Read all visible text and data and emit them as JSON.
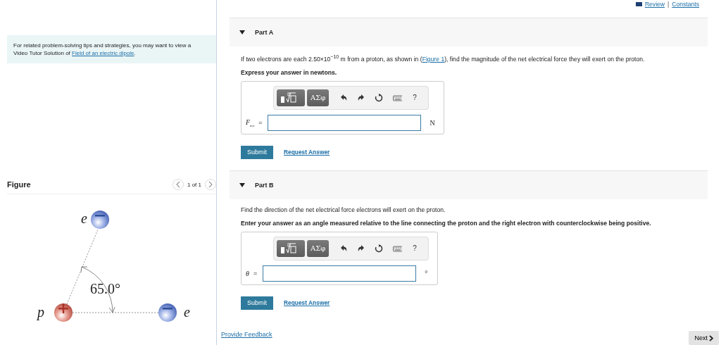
{
  "header_links": {
    "items": [
      {
        "label": "Review"
      },
      {
        "label": "Constants"
      }
    ],
    "separator": "|"
  },
  "tip": {
    "text": "For related problem-solving tips and strategies, you may want to view a Video Tutor Solution of ",
    "link": "Field of an electric dipole",
    "end": "."
  },
  "figure": {
    "title": "Figure",
    "counter": "1 of 1",
    "labels": {
      "top_electron": "e",
      "right_electron": "e",
      "proton": "p",
      "angle": "65.0°"
    }
  },
  "parts": [
    {
      "title": "Part A",
      "expanded": true,
      "question": "If two electrons are each 2.50×10$^{−10}$ m from a proton, as shown in (",
      "question_link": "Figure 1",
      "question_end": "), find the magnitude of the net electrical force they will exert on the proton.",
      "instruction": "Express your answer in newtons.",
      "toolbar": {
        "greek": "ΑΣφ",
        "help": "?"
      },
      "answer": {
        "variable": "F$_{net}$",
        "equals": "=",
        "unit": "N"
      },
      "buttons": {
        "submit": "Submit",
        "request": "Request Answer"
      }
    },
    {
      "title": "Part B",
      "expanded": true,
      "question": "Find the direction of the net electrical force electrons will exert on the proton.",
      "instruction": "Enter your answer as an angle measured relative to the line connecting the proton and the right electron with counterclockwise being positive.",
      "toolbar": {
        "greek": "ΑΣφ",
        "help": "?"
      },
      "answer": {
        "variable": "θ",
        "equals": "=",
        "unit": "°"
      },
      "buttons": {
        "submit": "Submit",
        "request": "Request Answer"
      }
    }
  ],
  "footer": {
    "feedback": "Provide Feedback",
    "next": "Next"
  }
}
